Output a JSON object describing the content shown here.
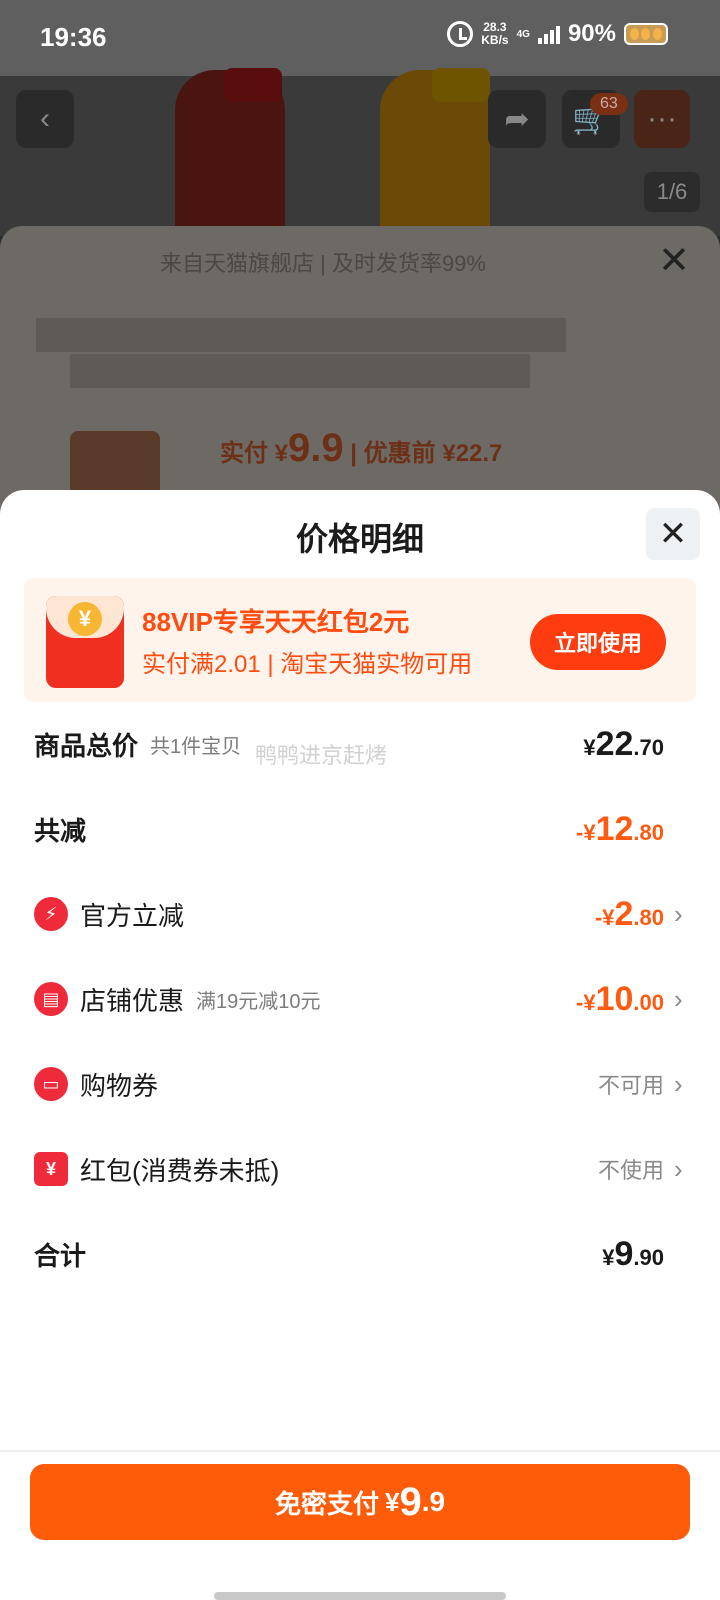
{
  "status_bar": {
    "time": "19:36",
    "speed_top": "28.3",
    "speed_bottom": "KB/s",
    "network": "4G",
    "battery": "90%"
  },
  "background": {
    "cart_count": "63",
    "image_index": "1/6",
    "store_line": "来自天猫旗舰店 | 及时发货率99%",
    "price_label": "实付 ¥",
    "price_value": "9.9",
    "price_before": " | 优惠前 ¥22.7"
  },
  "sheet": {
    "title": "价格明细",
    "promo": {
      "title": "88VIP专享天天红包2元",
      "subtitle": "实付满2.01 | 淘宝天猫实物可用",
      "button": "立即使用",
      "icon_glyph": "¥"
    },
    "watermark": "鸭鸭进京赶烤",
    "rows": [
      {
        "label": "商品总价",
        "note": "共1件宝贝",
        "sym": "¥",
        "int": "22",
        "dec": ".70"
      },
      {
        "label": "共减",
        "sym": "-¥",
        "int": "12",
        "dec": ".80"
      },
      {
        "label": "官方立减",
        "sym": "-¥",
        "int": "2",
        "dec": ".80"
      },
      {
        "label": "店铺优惠",
        "note": "满19元减10元",
        "sym": "-¥",
        "int": "10",
        "dec": ".00"
      },
      {
        "label": "购物券",
        "status": "不可用"
      },
      {
        "label": "红包(消费券未抵)",
        "status": "不使用"
      },
      {
        "label": "合计",
        "sym": "¥",
        "int": "9",
        "dec": ".90"
      }
    ],
    "pay_button": {
      "label": "免密支付",
      "sym": "¥",
      "int": "9",
      "dec": ".9"
    }
  },
  "colors": {
    "accent": "#ff5c0a",
    "discount": "#ff5a10",
    "icon_red": "#ef2b3b"
  }
}
